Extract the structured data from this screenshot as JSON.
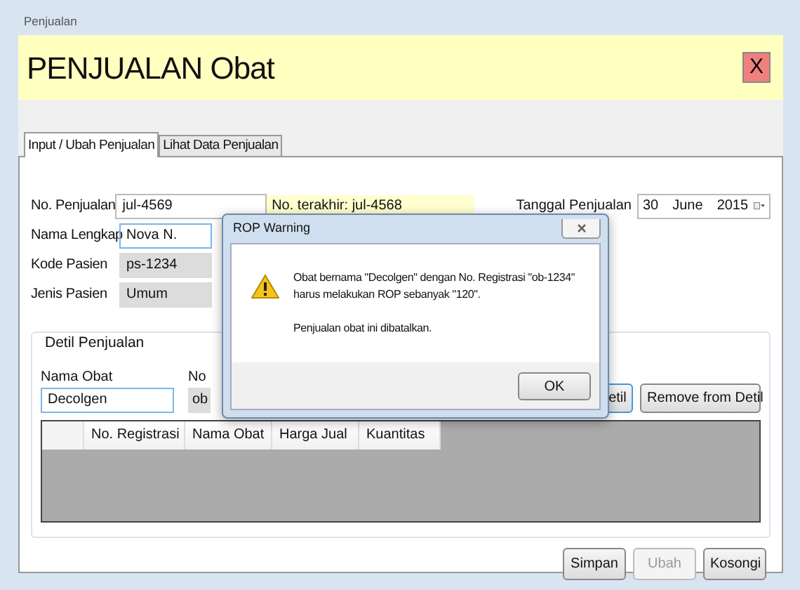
{
  "window": {
    "title": "Penjualan"
  },
  "header": {
    "title": "PENJUALAN Obat",
    "close": "X"
  },
  "tabs": [
    {
      "label": "Input / Ubah Penjualan",
      "selected": true
    },
    {
      "label": "Lihat Data Penjualan",
      "selected": false
    }
  ],
  "form": {
    "fields": [
      {
        "label": "No. Penjualan",
        "value": "jul-4569",
        "kind": "text"
      },
      {
        "label": "Nama Lengkap",
        "value": "Nova N.",
        "kind": "focused"
      },
      {
        "label": "Kode Pasien",
        "value": "ps-1234",
        "kind": "readonly"
      },
      {
        "label": "Jenis Pasien",
        "value": "Umum",
        "kind": "readonly"
      }
    ],
    "last_number": "No. terakhir: jul-4568",
    "date": {
      "label": "Tanggal Penjualan",
      "day": "30",
      "month": "June",
      "year": "2015"
    }
  },
  "detail": {
    "title": "Detil Penjualan",
    "drug_name": {
      "label": "Nama Obat",
      "value": "Decolgen"
    },
    "column_2": {
      "label": "No",
      "value": "ob"
    },
    "buttons": [
      {
        "label": "etil",
        "focused": true
      },
      {
        "label": "Remove from Detil",
        "focused": false
      }
    ],
    "table": {
      "columns": [
        "No. Registrasi",
        "Nama Obat",
        "Harga Jual",
        "Kuantitas"
      ]
    }
  },
  "buttons": [
    {
      "label": "Simpan",
      "disabled": false
    },
    {
      "label": "Ubah",
      "disabled": true
    },
    {
      "label": "Kosongi",
      "disabled": false
    }
  ],
  "dialog": {
    "title": "ROP Warning",
    "message": "Obat bernama \"Decolgen\" dengan No. Registrasi \"ob-1234\" harus melakukan ROP sebanyak \"120\".",
    "note": "Penjualan obat ini dibatalkan.",
    "button": "OK"
  }
}
